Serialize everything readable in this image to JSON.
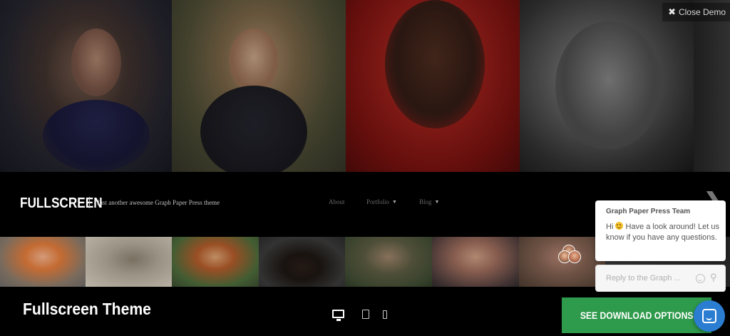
{
  "demo": {
    "close_label": "Close Demo",
    "title": "Fullscreen Theme",
    "download_label": "SEE DOWNLOAD OPTIONS"
  },
  "site": {
    "brand": "FULLSCREEN",
    "tagline": "Just another awesome Graph Paper Press theme",
    "nav": [
      {
        "label": "About"
      },
      {
        "label": "Portfolio"
      },
      {
        "label": "Blog"
      }
    ]
  },
  "chat": {
    "team": "Graph Paper Press Team",
    "message_prefix": "Hi",
    "message_body": "Have a look around! Let us know if you have any questions.",
    "reply_placeholder": "Reply to the Graph ..."
  },
  "colors": {
    "download_button": "#2e9a4c",
    "chat_launcher": "#2a7dd1"
  }
}
